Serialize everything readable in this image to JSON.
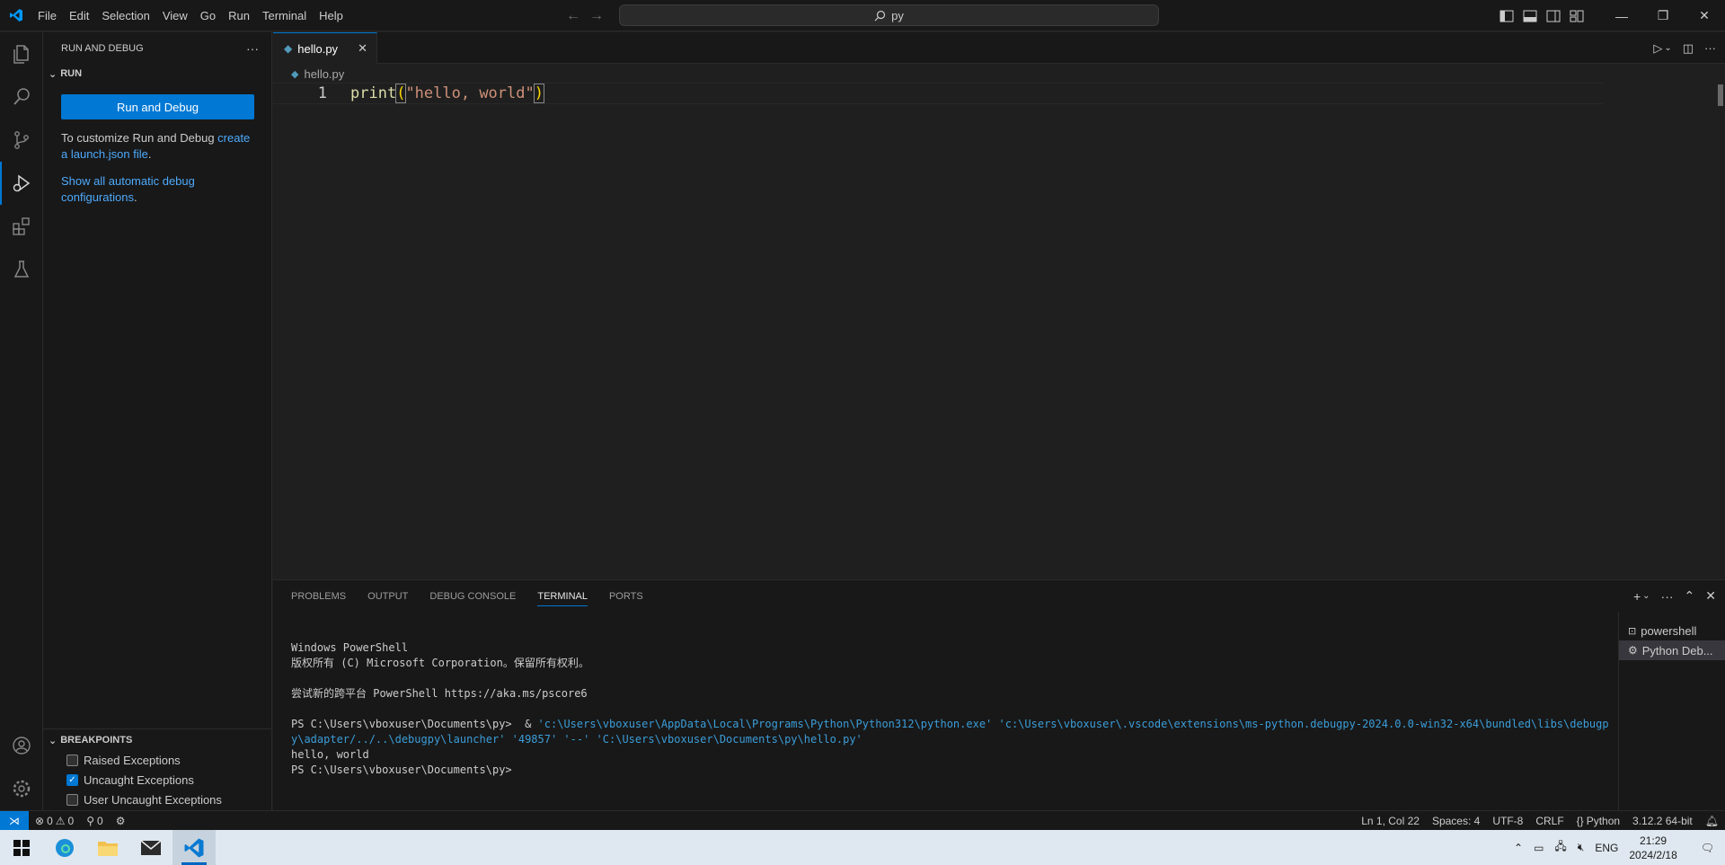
{
  "menu": [
    "File",
    "Edit",
    "Selection",
    "View",
    "Go",
    "Run",
    "Terminal",
    "Help"
  ],
  "search": {
    "value": "py"
  },
  "sidebar": {
    "title": "RUN AND DEBUG",
    "section": "RUN",
    "run_button": "Run and Debug",
    "customize_text": "To customize Run and Debug ",
    "customize_link": "create a launch.json file",
    "customize_end": ".",
    "show_link": "Show all automatic debug configurations",
    "show_end": ".",
    "breakpoints_title": "BREAKPOINTS",
    "breakpoints": [
      {
        "label": "Raised Exceptions",
        "checked": false
      },
      {
        "label": "Uncaught Exceptions",
        "checked": true
      },
      {
        "label": "User Uncaught Exceptions",
        "checked": false
      }
    ]
  },
  "editor": {
    "tab": "hello.py",
    "breadcrumb": "hello.py",
    "line_number": "1",
    "code_fn": "print",
    "code_open": "(",
    "code_str": "\"hello, world\"",
    "code_close": ")"
  },
  "panel": {
    "tabs": [
      "PROBLEMS",
      "OUTPUT",
      "DEBUG CONSOLE",
      "TERMINAL",
      "PORTS"
    ],
    "active_tab": "TERMINAL",
    "terminal": {
      "l1": "Windows PowerShell",
      "l2": "版权所有 (C) Microsoft Corporation。保留所有权利。",
      "l3": "尝试新的跨平台 PowerShell https://aka.ms/pscore6",
      "l4_prompt": "PS C:\\Users\\vboxuser\\Documents\\py>  & ",
      "l4_cmd": "'c:\\Users\\vboxuser\\AppData\\Local\\Programs\\Python\\Python312\\python.exe' 'c:\\Users\\vboxuser\\.vscode\\extensions\\ms-python.debugpy-2024.0.0-win32-x64\\bundled\\libs\\debugpy\\adapter/../..\\debugpy\\launcher' '49857' '--' 'C:\\Users\\vboxuser\\Documents\\py\\hello.py'",
      "l5": "hello, world",
      "l6": "PS C:\\Users\\vboxuser\\Documents\\py>"
    },
    "terminals": [
      "powershell",
      "Python Deb..."
    ]
  },
  "status": {
    "errors": "0",
    "warnings": "0",
    "ports": "0",
    "position": "Ln 1, Col 22",
    "spaces": "Spaces: 4",
    "encoding": "UTF-8",
    "eol": "CRLF",
    "language": "Python",
    "interpreter": "3.12.2 64-bit"
  },
  "taskbar": {
    "lang": "ENG",
    "time": "21:29",
    "date": "2024/2/18"
  },
  "colors": {
    "accent": "#0078d4",
    "link": "#4daafc",
    "string": "#ce9178",
    "function": "#dcdcaa"
  }
}
